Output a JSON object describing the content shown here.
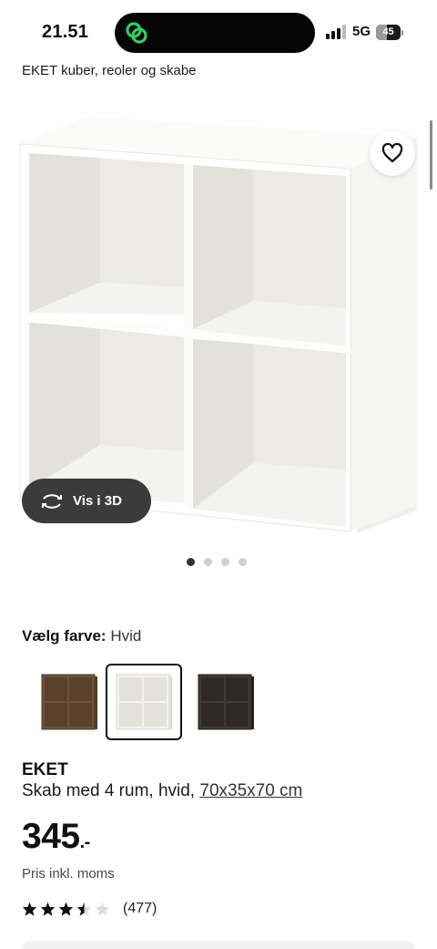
{
  "status_bar": {
    "time": "21.51",
    "network": "5G",
    "battery": "45",
    "battery_level": 0.45
  },
  "breadcrumb": "EKET kuber, reoler og skabe",
  "gallery": {
    "view_3d_label": "Vis i 3D",
    "dot_count": 4,
    "active_dot": 0,
    "favorite_icon": "heart-outline-icon"
  },
  "color_picker": {
    "label": "Vælg farve:",
    "selected": "Hvid",
    "swatches": [
      {
        "name": "walnut",
        "color": "#6b533e"
      },
      {
        "name": "white",
        "color": "#f4f3ef"
      },
      {
        "name": "dark-grey",
        "color": "#3f3b38"
      }
    ],
    "selected_index": 1
  },
  "product": {
    "name": "EKET",
    "description": "Skab med 4 rum, hvid,",
    "dimensions": "70x35x70 cm",
    "price": "345",
    "price_suffix": ".-",
    "price_note": "Pris inkl. moms",
    "rating": 3.5,
    "max_rating": 5,
    "review_count": "(477)"
  },
  "colors": {
    "text": "#111111",
    "dark_button": "#3b3b3b",
    "star": "#111111",
    "star_empty": "#dcdcdc"
  }
}
